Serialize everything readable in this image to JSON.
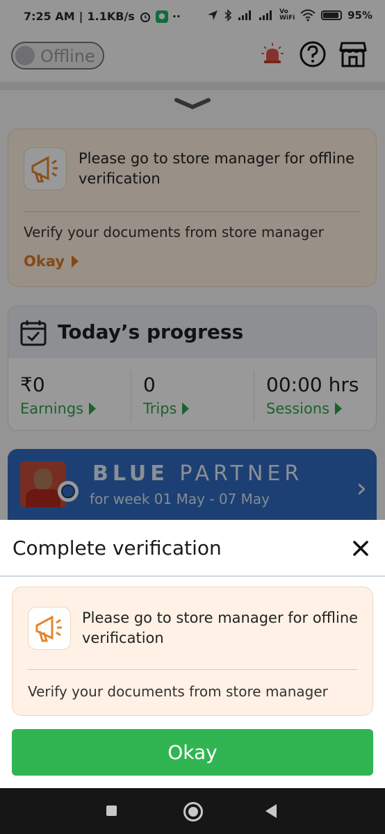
{
  "status_bar": {
    "time": "7:25 AM",
    "speed": "1.1KB/s",
    "battery": "95%",
    "volte": "Vo WiFi"
  },
  "app_bar": {
    "status_toggle_label": "Offline",
    "icons": [
      "siren-icon",
      "help-icon",
      "store-icon"
    ]
  },
  "verification_card": {
    "title": "Please go to store manager for offline verification",
    "subtitle": "Verify your documents from store manager",
    "action_label": "Okay"
  },
  "progress": {
    "title": "Today’s progress",
    "stats": [
      {
        "value": "₹0",
        "label": "Earnings"
      },
      {
        "value": "0",
        "label": "Trips"
      },
      {
        "value": "00:00 hrs",
        "label": "Sessions"
      }
    ]
  },
  "partner": {
    "tier_bold": "BLUE",
    "tier_rest": "PARTNER",
    "week_text": "for week 01 May - 07 May"
  },
  "sheet": {
    "title": "Complete verification",
    "card_title": "Please go to store manager for offline verification",
    "card_subtitle": "Verify your documents from store manager",
    "button_label": "Okay"
  },
  "colors": {
    "accent_green": "#31b553",
    "card_orange_bg": "#fff1e6",
    "link_orange": "#e07a26",
    "partner_blue": "#2f6cc0"
  }
}
